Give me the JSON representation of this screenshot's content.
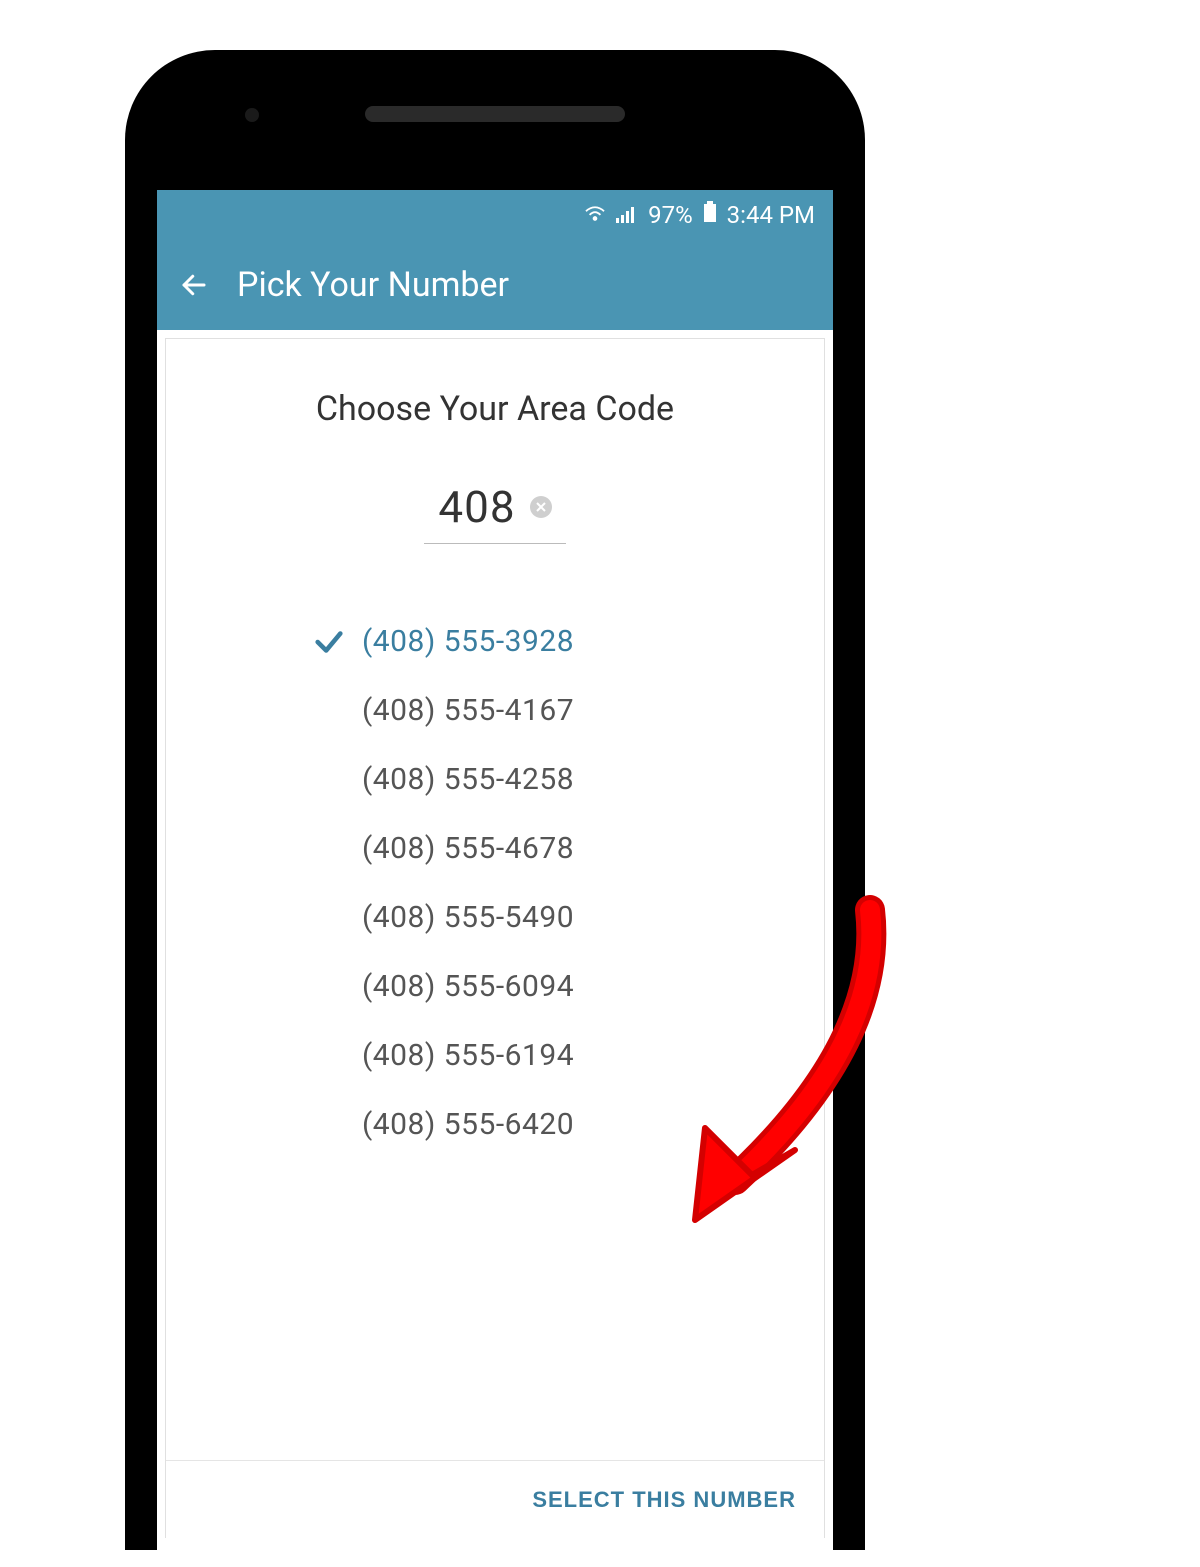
{
  "status_bar": {
    "battery_percent": "97%",
    "time": "3:44 PM"
  },
  "app_bar": {
    "title": "Pick Your Number"
  },
  "main": {
    "heading": "Choose Your Area Code",
    "area_code": "408",
    "numbers": [
      {
        "label": "(408) 555-3928",
        "selected": true
      },
      {
        "label": "(408) 555-4167",
        "selected": false
      },
      {
        "label": "(408) 555-4258",
        "selected": false
      },
      {
        "label": "(408) 555-4678",
        "selected": false
      },
      {
        "label": "(408) 555-5490",
        "selected": false
      },
      {
        "label": "(408) 555-6094",
        "selected": false
      },
      {
        "label": "(408) 555-6194",
        "selected": false
      },
      {
        "label": "(408) 555-6420",
        "selected": false
      }
    ]
  },
  "footer": {
    "select_label": "SELECT THIS NUMBER"
  }
}
